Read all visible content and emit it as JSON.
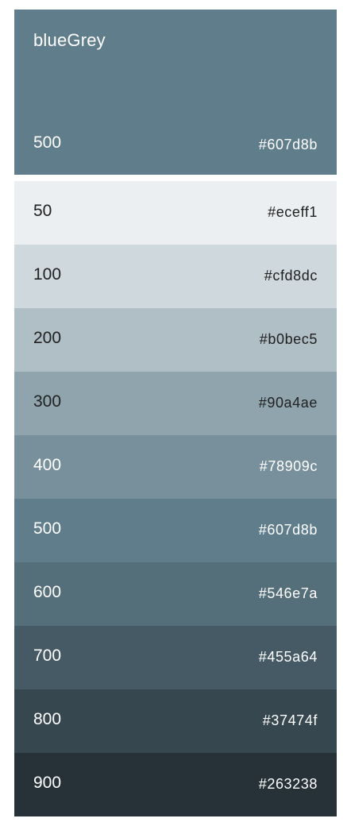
{
  "header": {
    "name": "blueGrey",
    "shade": "500",
    "hex": "#607d8b",
    "background": "#607d8b",
    "text_color": "#ffffff"
  },
  "swatches": [
    {
      "shade": "50",
      "hex": "#eceff1",
      "background": "#eceff1",
      "text_color": "#212121"
    },
    {
      "shade": "100",
      "hex": "#cfd8dc",
      "background": "#cfd8dc",
      "text_color": "#212121"
    },
    {
      "shade": "200",
      "hex": "#b0bec5",
      "background": "#b0bec5",
      "text_color": "#212121"
    },
    {
      "shade": "300",
      "hex": "#90a4ae",
      "background": "#90a4ae",
      "text_color": "#212121"
    },
    {
      "shade": "400",
      "hex": "#78909c",
      "background": "#78909c",
      "text_color": "#ffffff"
    },
    {
      "shade": "500",
      "hex": "#607d8b",
      "background": "#607d8b",
      "text_color": "#ffffff"
    },
    {
      "shade": "600",
      "hex": "#546e7a",
      "background": "#546e7a",
      "text_color": "#ffffff"
    },
    {
      "shade": "700",
      "hex": "#455a64",
      "background": "#455a64",
      "text_color": "#ffffff"
    },
    {
      "shade": "800",
      "hex": "#37474f",
      "background": "#37474f",
      "text_color": "#ffffff"
    },
    {
      "shade": "900",
      "hex": "#263238",
      "background": "#263238",
      "text_color": "#ffffff"
    }
  ]
}
